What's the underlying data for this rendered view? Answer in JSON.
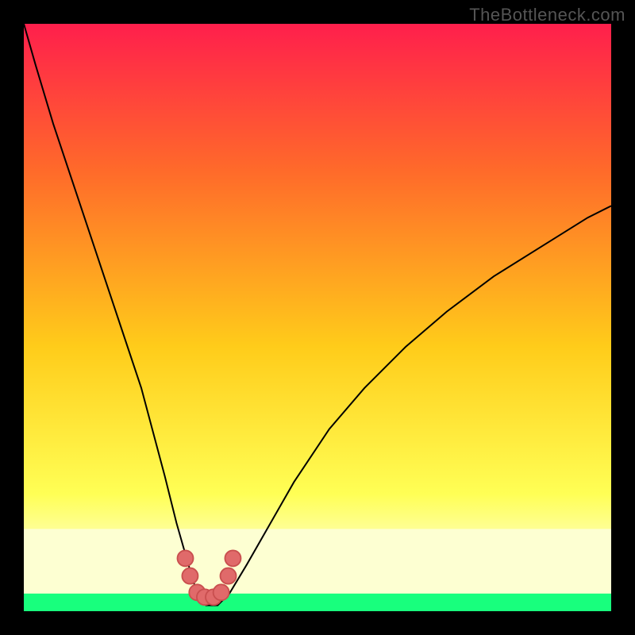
{
  "watermark": "TheBottleneck.com",
  "colors": {
    "frame_bg": "#000000",
    "gradient_top": "#ff1f4c",
    "gradient_mid_upper": "#ff6a2a",
    "gradient_mid": "#ffcc1a",
    "gradient_lower": "#ffff55",
    "gradient_pale": "#fdffd2",
    "green_band": "#18ff7d",
    "curve_stroke": "#000000",
    "marker_fill": "#e06a6a",
    "marker_stroke": "#c94f4f"
  },
  "chart_data": {
    "type": "line",
    "title": "",
    "xlabel": "",
    "ylabel": "",
    "xlim": [
      0,
      100
    ],
    "ylim": [
      0,
      100
    ],
    "series": [
      {
        "name": "bottleneck-curve",
        "x": [
          0,
          2,
          5,
          8,
          12,
          16,
          20,
          24,
          26,
          28,
          29.5,
          31,
          33,
          35,
          38,
          42,
          46,
          52,
          58,
          65,
          72,
          80,
          88,
          96,
          100
        ],
        "y": [
          100,
          93,
          83,
          74,
          62,
          50,
          38,
          23,
          15,
          8,
          3,
          1,
          1,
          3,
          8,
          15,
          22,
          31,
          38,
          45,
          51,
          57,
          62,
          67,
          69
        ]
      }
    ],
    "markers": {
      "name": "highlight-points",
      "x": [
        27.5,
        28.3,
        29.5,
        30.8,
        32.3,
        33.6,
        34.8,
        35.6
      ],
      "y": [
        9,
        6,
        3.2,
        2.4,
        2.4,
        3.2,
        6,
        9
      ]
    },
    "green_band": {
      "y_from": 0,
      "y_to": 3
    },
    "pale_band": {
      "y_from": 3,
      "y_to": 14
    }
  }
}
